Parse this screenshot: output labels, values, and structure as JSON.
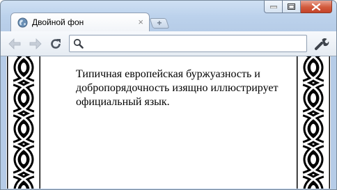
{
  "window": {
    "caption_buttons": [
      "minimize",
      "maximize",
      "close"
    ]
  },
  "tab": {
    "title": "Двойной фон",
    "favicon": "globe-icon",
    "close_glyph": "×"
  },
  "new_tab_glyph": "+",
  "toolbar": {
    "back_icon": "back-arrow-icon",
    "forward_icon": "forward-arrow-icon",
    "reload_icon": "reload-icon",
    "address_value": "",
    "address_placeholder": "",
    "menu_icon": "wrench-icon"
  },
  "page": {
    "paragraph": "Типичная европейская буржуазность и добропорядочность изящно иллюстрирует официальный язык.",
    "border_pattern": "celtic-knot"
  },
  "colors": {
    "frame": "#bcd2ec",
    "close_button": "#d25a3c",
    "content_bg": "#ffffff",
    "text": "#000000"
  }
}
